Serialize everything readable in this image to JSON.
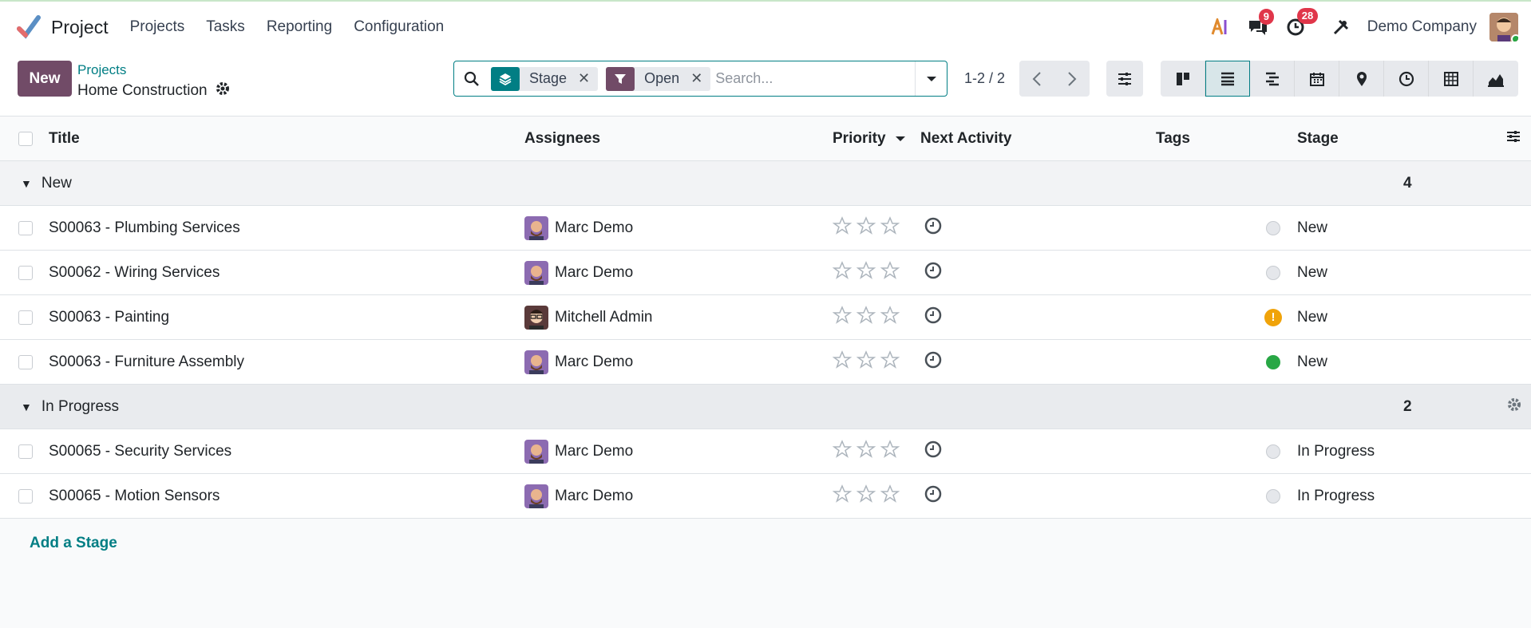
{
  "app": {
    "name": "Project",
    "menu": [
      "Projects",
      "Tasks",
      "Reporting",
      "Configuration"
    ],
    "company": "Demo Company",
    "messages_count": "9",
    "activities_count": "28"
  },
  "control": {
    "new_label": "New",
    "breadcrumb": "Projects",
    "record_title": "Home Construction",
    "facets": [
      {
        "label": "Stage",
        "icon": "layers-icon",
        "color": "#017e84"
      },
      {
        "label": "Open",
        "icon": "filter-icon",
        "color": "#714b67"
      }
    ],
    "search_placeholder": "Search...",
    "pager": "1-2 / 2"
  },
  "columns": {
    "title": "Title",
    "assignees": "Assignees",
    "priority": "Priority",
    "next_activity": "Next Activity",
    "tags": "Tags",
    "stage": "Stage"
  },
  "groups": [
    {
      "name": "New",
      "count": "4",
      "rows": [
        {
          "title": "S00063 - Plumbing Services",
          "assignee": "Marc Demo",
          "status": "normal",
          "stage": "New"
        },
        {
          "title": "S00062 - Wiring Services",
          "assignee": "Marc Demo",
          "status": "normal",
          "stage": "New"
        },
        {
          "title": "S00063 - Painting",
          "assignee": "Mitchell Admin",
          "status": "warning",
          "stage": "New"
        },
        {
          "title": "S00063 - Furniture Assembly",
          "assignee": "Marc Demo",
          "status": "done",
          "stage": "New"
        }
      ]
    },
    {
      "name": "In Progress",
      "count": "2",
      "rows": [
        {
          "title": "S00065 - Security Services",
          "assignee": "Marc Demo",
          "status": "normal",
          "stage": "In Progress"
        },
        {
          "title": "S00065 - Motion Sensors",
          "assignee": "Marc Demo",
          "status": "normal",
          "stage": "In Progress"
        }
      ]
    }
  ],
  "add_stage_label": "Add a Stage",
  "colors": {
    "brand": "#714b67",
    "accent": "#017e84",
    "status_normal": "#e5e7eb",
    "status_warning": "#f0a30a",
    "status_done": "#28a745"
  }
}
